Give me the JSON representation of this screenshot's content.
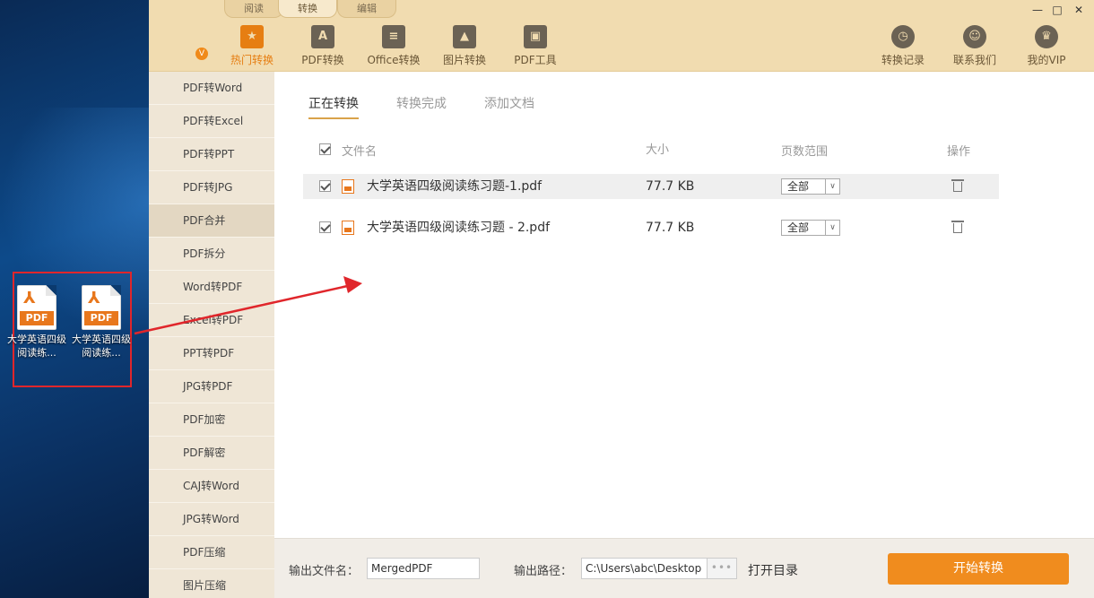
{
  "desktop": {
    "icons": [
      {
        "label": "大学英语四级阅读练...",
        "file_badge": "PDF"
      },
      {
        "label": "大学英语四级阅读练...",
        "file_badge": "PDF"
      }
    ]
  },
  "window": {
    "top_tabs": [
      "阅读",
      "转换",
      "编辑"
    ],
    "active_top_tab": "转换",
    "controls": {
      "minimize": "—",
      "maximize": "□",
      "close": "✕"
    }
  },
  "toolbar": {
    "vip_badge": "V",
    "tools": [
      {
        "label": "热门转换",
        "icon": "star-icon",
        "glyph": "★"
      },
      {
        "label": "PDF转换",
        "icon": "pdf-icon",
        "glyph": "A"
      },
      {
        "label": "Office转换",
        "icon": "document-icon",
        "glyph": "≡"
      },
      {
        "label": "图片转换",
        "icon": "image-icon",
        "glyph": "▲"
      },
      {
        "label": "PDF工具",
        "icon": "toolbox-icon",
        "glyph": "▣"
      }
    ],
    "right_tools": [
      {
        "label": "转换记录",
        "icon": "clock-icon",
        "glyph": "◷"
      },
      {
        "label": "联系我们",
        "icon": "headset-icon",
        "glyph": "☺"
      },
      {
        "label": "我的VIP",
        "icon": "crown-icon",
        "glyph": "♛"
      }
    ]
  },
  "sidebar": {
    "items": [
      "PDF转Word",
      "PDF转Excel",
      "PDF转PPT",
      "PDF转JPG",
      "PDF合并",
      "PDF拆分",
      "Word转PDF",
      "Excel转PDF",
      "PPT转PDF",
      "JPG转PDF",
      "PDF加密",
      "PDF解密",
      "CAJ转Word",
      "JPG转Word",
      "PDF压缩",
      "图片压缩"
    ],
    "active": "PDF合并"
  },
  "main": {
    "subtabs": [
      "正在转换",
      "转换完成",
      "添加文档"
    ],
    "active_subtab": "正在转换",
    "columns": {
      "name": "文件名",
      "size": "大小",
      "range": "页数范围",
      "action": "操作"
    },
    "files": [
      {
        "name": "大学英语四级阅读练习题-1.pdf",
        "size": "77.7 KB",
        "range": "全部",
        "checked": true
      },
      {
        "name": "大学英语四级阅读练习题 - 2.pdf",
        "size": "77.7 KB",
        "range": "全部",
        "checked": true
      }
    ]
  },
  "bottom": {
    "output_name_label": "输出文件名：",
    "output_name_value": "MergedPDF",
    "output_path_label": "输出路径：",
    "output_path_value": "C:\\Users\\abc\\Desktop",
    "browse_label": "•••",
    "open_folder": "打开目录",
    "start_button": "开始转换"
  },
  "colors": {
    "accent": "#f08c1e",
    "toolbar_bg": "#f1dcb0",
    "sidebar_bg": "#efe6d6",
    "annotation_red": "#e0262b"
  }
}
